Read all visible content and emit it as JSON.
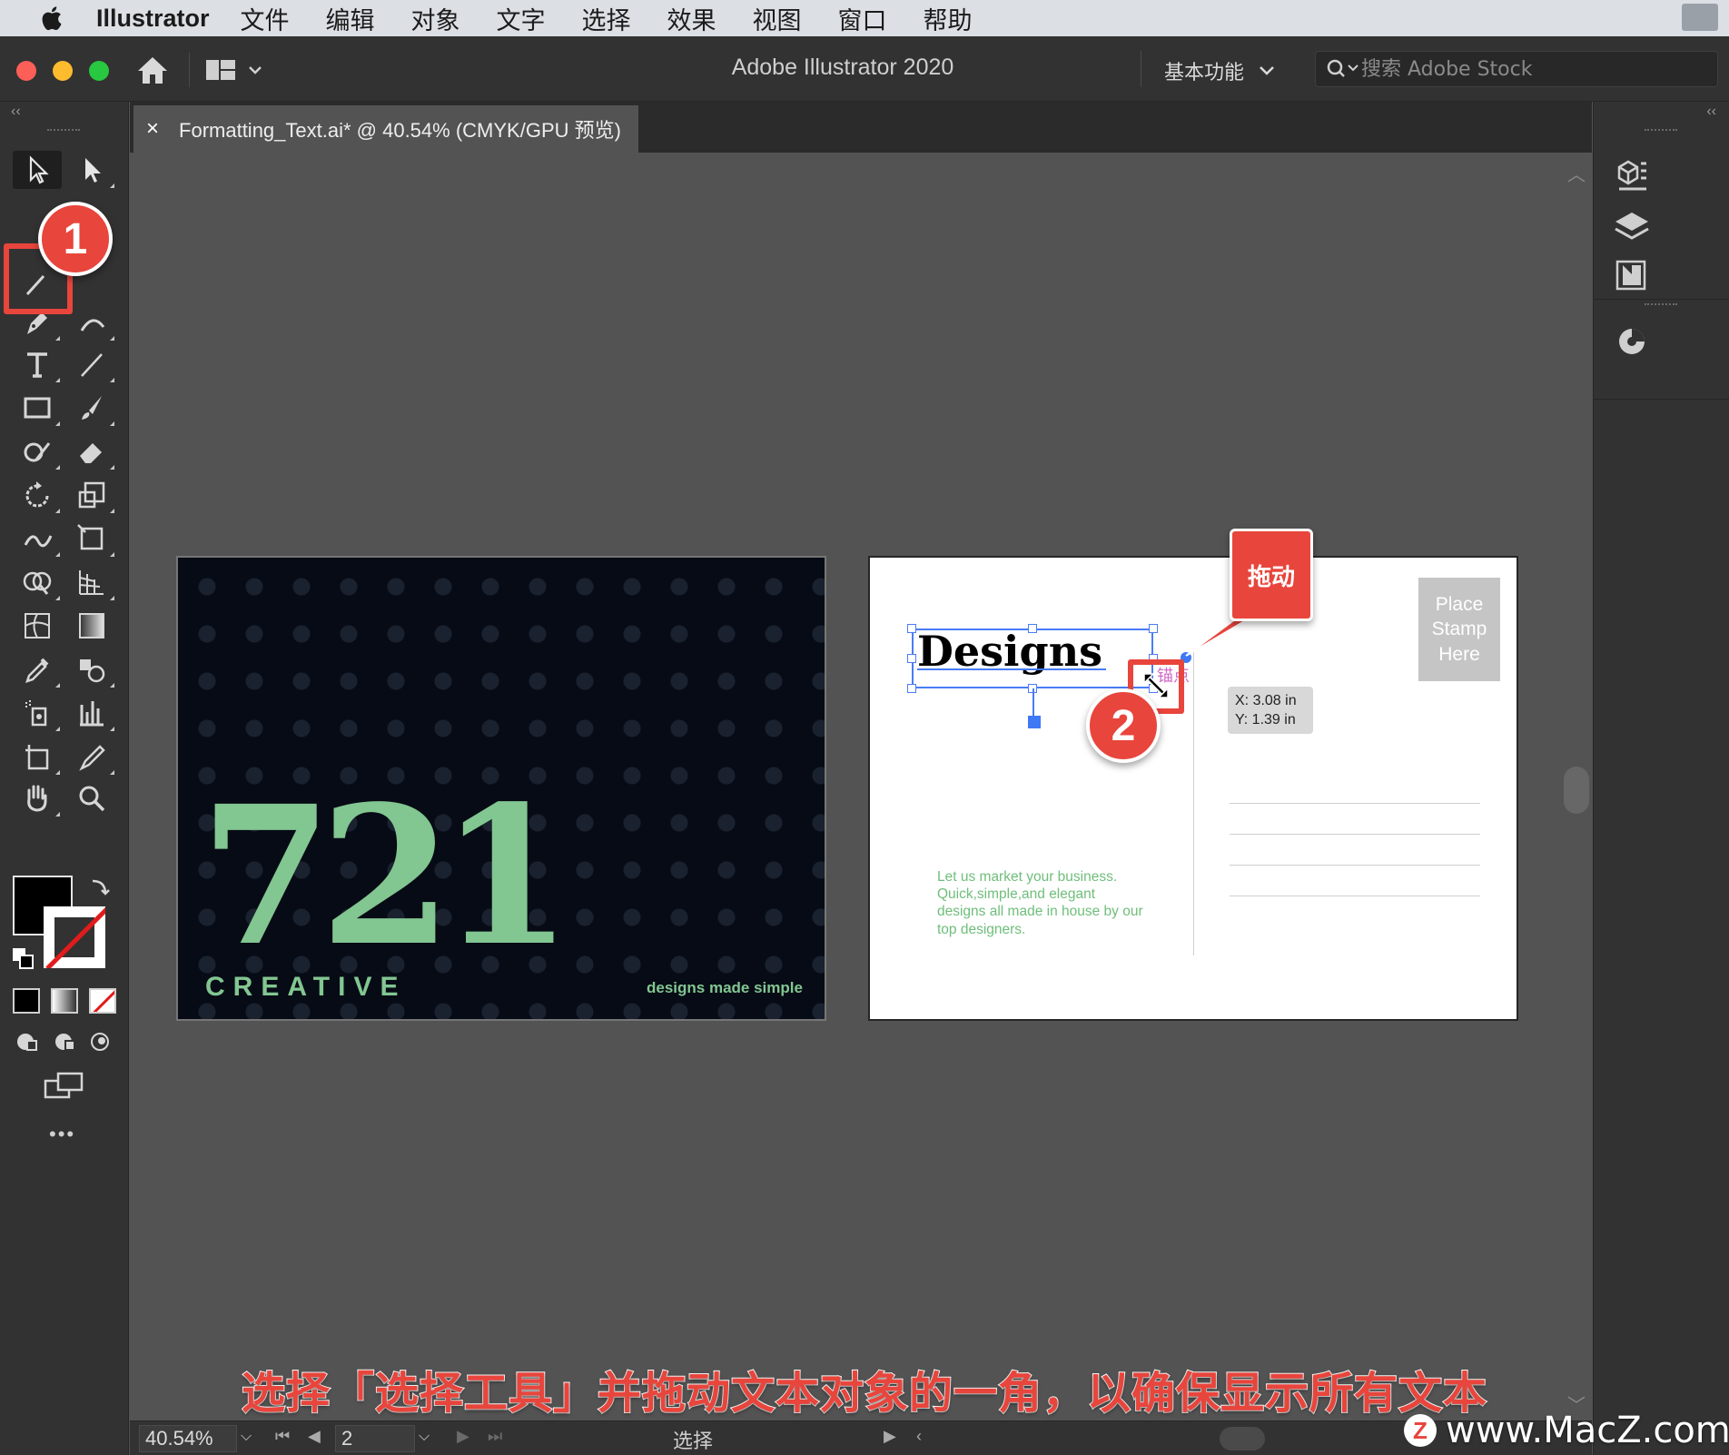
{
  "menubar": {
    "app_name": "Illustrator",
    "items": [
      "文件",
      "编辑",
      "对象",
      "文字",
      "选择",
      "效果",
      "视图",
      "窗口",
      "帮助"
    ]
  },
  "titlebar": {
    "title": "Adobe Illustrator 2020",
    "workspace": "基本功能",
    "search_placeholder": "搜索 Adobe Stock"
  },
  "document_tab": {
    "close": "×",
    "title": "Formatting_Text.ai* @ 40.54% (CMYK/GPU 预览)"
  },
  "toolbar": {
    "tools": [
      "selection-tool",
      "direct-selection-tool",
      "magic-wand-tool",
      "pen-tool",
      "type-tool",
      "line-tool",
      "rectangle-tool",
      "paintbrush-tool",
      "shaper-tool",
      "eraser-tool",
      "rotate-tool",
      "scale-tool",
      "warp-tool",
      "free-transform-tool",
      "shape-builder-tool",
      "perspective-grid-tool",
      "mesh-tool",
      "gradient-tool",
      "eyedropper-tool",
      "blend-tool",
      "symbol-sprayer-tool",
      "column-graph-tool",
      "artboard-tool",
      "slice-tool",
      "hand-tool",
      "zoom-tool"
    ],
    "fill_color": "#000000",
    "stroke": "none",
    "more": "•••"
  },
  "callouts": {
    "step1": "1",
    "step2": "2",
    "drag": "拖动"
  },
  "artboard1": {
    "number": "721",
    "brand": "CREATIVE",
    "tagline": "designs made simple",
    "accent_color": "#82c691"
  },
  "artboard2": {
    "headline": "Designs",
    "stamp": "Place Stamp Here",
    "body": "Let us market your business. Quick,simple,and elegant designs all made in house by our top designers.",
    "anchor_label": "锚点",
    "coord_x": "X: 3.08 in",
    "coord_y": "Y: 1.39 in"
  },
  "statusbar": {
    "zoom": "40.54%",
    "page": "2",
    "tool_name": "选择"
  },
  "caption": "选择「选择工具」并拖动文本对象的一角，以确保显示所有文本",
  "watermark": {
    "logo": "Z",
    "text": "www.MacZ.com"
  }
}
